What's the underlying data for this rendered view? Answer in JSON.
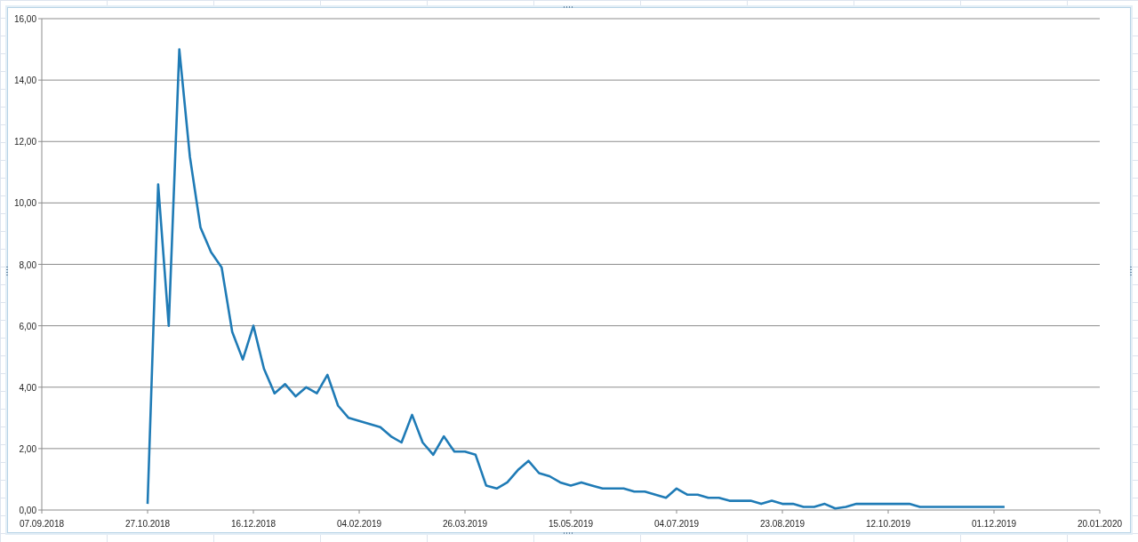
{
  "chart": {
    "chart_data": {
      "type": "line",
      "categories": [
        "07.09.2018",
        null,
        null,
        null,
        null,
        null,
        null,
        null,
        null,
        null,
        "27.10.2018",
        null,
        null,
        null,
        null,
        null,
        null,
        null,
        null,
        null,
        "16.12.2018",
        null,
        null,
        null,
        null,
        null,
        null,
        null,
        null,
        null,
        "04.02.2019",
        null,
        null,
        null,
        null,
        null,
        null,
        null,
        null,
        null,
        "26.03.2019",
        null,
        null,
        null,
        null,
        null,
        null,
        null,
        null,
        null,
        "15.05.2019",
        null,
        null,
        null,
        null,
        null,
        null,
        null,
        null,
        null,
        "04.07.2019",
        null,
        null,
        null,
        null,
        null,
        null,
        null,
        null,
        null,
        "23.08.2019",
        null,
        null,
        null,
        null,
        null,
        null,
        null,
        null,
        null,
        "12.10.2019",
        null,
        null,
        null,
        null,
        null,
        null,
        null,
        null,
        null,
        "01.12.2019",
        null,
        null,
        null,
        null,
        null,
        null,
        null,
        null,
        null,
        "20.01.2020"
      ],
      "series": [
        {
          "color": "#1f7bb6",
          "values": [
            null,
            null,
            null,
            null,
            null,
            null,
            null,
            null,
            null,
            null,
            0.2,
            10.6,
            6.0,
            15,
            11.5,
            9.2,
            8.4,
            7.9,
            5.8,
            4.9,
            6.0,
            4.6,
            3.8,
            4.1,
            3.7,
            4.0,
            3.8,
            4.4,
            3.4,
            3.0,
            2.9,
            2.8,
            2.7,
            2.4,
            2.2,
            3.1,
            2.2,
            1.8,
            2.4,
            1.9,
            1.9,
            1.8,
            0.8,
            0.7,
            0.9,
            1.3,
            1.6,
            1.2,
            1.1,
            0.9,
            0.8,
            0.9,
            0.8,
            0.7,
            0.7,
            0.7,
            0.6,
            0.6,
            0.5,
            0.4,
            0.7,
            0.5,
            0.5,
            0.4,
            0.4,
            0.3,
            0.3,
            0.3,
            0.2,
            0.3,
            0.2,
            0.2,
            0.1,
            0.1,
            0.2,
            0.05,
            0.1,
            0.2,
            0.2,
            0.2,
            0.2,
            0.2,
            0.2,
            0.1,
            0.1,
            0.1,
            0.1,
            0.1,
            0.1,
            0.1,
            0.1,
            0.1,
            null,
            null,
            null,
            null,
            null,
            null,
            null,
            null,
            null
          ]
        }
      ],
      "ylim": [
        0,
        16
      ],
      "grid": true,
      "yticks": [
        {
          "value": 0,
          "label": "0,00"
        },
        {
          "value": 2,
          "label": "2,00"
        },
        {
          "value": 4,
          "label": "4,00"
        },
        {
          "value": 6,
          "label": "6,00"
        },
        {
          "value": 8,
          "label": "8,00"
        },
        {
          "value": 10,
          "label": "10,00"
        },
        {
          "value": 12,
          "label": "12,00"
        },
        {
          "value": 14,
          "label": "14,00"
        },
        {
          "value": 16,
          "label": "16,00"
        }
      ]
    }
  }
}
